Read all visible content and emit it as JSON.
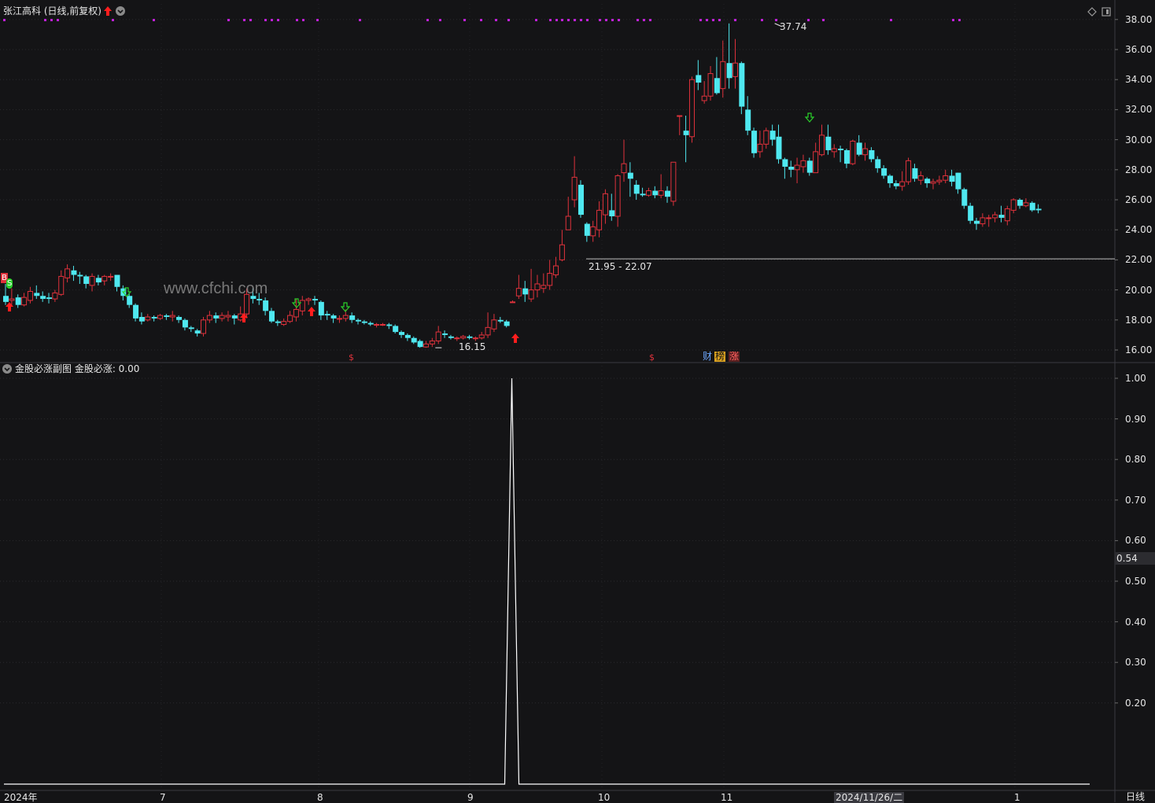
{
  "header": {
    "title": "张江高科 (日线,前复权)",
    "sub_title": "金股必涨副图  金股必涨: 0.00",
    "watermark": "www.cfchi.com",
    "period_label": "日线",
    "cursor_value": "0.54"
  },
  "annotations": {
    "high_label": "37.74",
    "low_label": "16.15",
    "range_label": "21.95 - 22.07",
    "b_marker": "B",
    "s_marker": "S",
    "dollar_marker": "$",
    "events": [
      "财",
      "榜",
      "涨"
    ]
  },
  "price_axis": [
    "38.00",
    "36.00",
    "34.00",
    "32.00",
    "30.00",
    "28.00",
    "26.00",
    "24.00",
    "22.00",
    "20.00",
    "18.00",
    "16.00"
  ],
  "indicator_axis": [
    "1.00",
    "0.90",
    "0.80",
    "0.70",
    "0.60",
    "0.50",
    "0.40",
    "0.30",
    "0.20"
  ],
  "date_axis": [
    "2024年",
    "7",
    "8",
    "9",
    "10",
    "11",
    "2024/11/26/二",
    "1"
  ],
  "colors": {
    "up": "#e0323c",
    "down": "#4fe8f0",
    "marker": "#c020d8",
    "arrow_up": "#ff1e1e",
    "arrow_down": "#2ad02a"
  },
  "chart_data": {
    "type": "candlestick",
    "price_range": [
      15.5,
      38.5
    ],
    "candles": [
      [
        19.6,
        19.2,
        20.4,
        19.0
      ],
      [
        19.3,
        19.4,
        20.1,
        19.0
      ],
      [
        19.5,
        19.0,
        19.7,
        18.8
      ],
      [
        19.0,
        19.5,
        19.8,
        18.9
      ],
      [
        19.3,
        19.9,
        20.2,
        19.1
      ],
      [
        19.8,
        19.6,
        20.3,
        19.4
      ],
      [
        19.6,
        19.4,
        19.9,
        19.2
      ],
      [
        19.5,
        19.4,
        19.8,
        19.1
      ],
      [
        19.4,
        19.8,
        20.0,
        19.2
      ],
      [
        19.7,
        20.9,
        21.3,
        19.6
      ],
      [
        20.8,
        21.4,
        21.7,
        20.5
      ],
      [
        21.3,
        21.0,
        21.6,
        20.6
      ],
      [
        21.0,
        20.9,
        21.2,
        20.4
      ],
      [
        20.9,
        20.4,
        21.0,
        20.1
      ],
      [
        20.3,
        20.9,
        21.1,
        19.9
      ],
      [
        20.8,
        20.5,
        21.0,
        20.3
      ],
      [
        20.6,
        20.9,
        21.0,
        20.3
      ],
      [
        20.9,
        20.9,
        21.1,
        20.6
      ],
      [
        21.0,
        20.2,
        21.0,
        19.9
      ],
      [
        20.1,
        19.6,
        20.3,
        19.3
      ],
      [
        19.6,
        19.0,
        19.8,
        18.8
      ],
      [
        19.0,
        18.1,
        19.1,
        17.9
      ],
      [
        18.2,
        17.9,
        18.5,
        17.7
      ],
      [
        18.0,
        18.2,
        18.4,
        17.9
      ],
      [
        18.2,
        18.1,
        18.3,
        17.9
      ],
      [
        18.1,
        18.3,
        18.4,
        18.0
      ],
      [
        18.3,
        18.2,
        18.4,
        18.0
      ],
      [
        18.2,
        18.3,
        18.6,
        17.9
      ],
      [
        18.2,
        18.0,
        18.3,
        17.8
      ],
      [
        18.0,
        17.5,
        18.1,
        17.3
      ],
      [
        17.5,
        17.4,
        17.6,
        17.2
      ],
      [
        17.3,
        17.1,
        17.4,
        16.9
      ],
      [
        17.1,
        18.0,
        18.2,
        16.9
      ],
      [
        18.0,
        18.3,
        18.6,
        17.8
      ],
      [
        18.3,
        18.1,
        18.5,
        17.8
      ],
      [
        18.1,
        18.3,
        18.5,
        17.9
      ],
      [
        18.2,
        18.3,
        18.6,
        17.9
      ],
      [
        18.3,
        18.1,
        18.4,
        17.7
      ],
      [
        18.0,
        18.4,
        18.9,
        17.9
      ],
      [
        18.4,
        19.7,
        20.1,
        18.1
      ],
      [
        19.6,
        19.4,
        20.1,
        19.1
      ],
      [
        19.4,
        19.3,
        19.8,
        19.0
      ],
      [
        19.3,
        18.6,
        19.5,
        18.3
      ],
      [
        18.6,
        17.9,
        18.8,
        17.8
      ],
      [
        17.9,
        17.8,
        18.0,
        17.6
      ],
      [
        17.7,
        17.9,
        18.1,
        17.6
      ],
      [
        17.9,
        18.3,
        18.6,
        17.8
      ],
      [
        18.2,
        18.7,
        19.4,
        17.9
      ],
      [
        18.6,
        19.3,
        19.6,
        18.3
      ],
      [
        19.3,
        19.4,
        19.5,
        19.0
      ],
      [
        19.4,
        19.3,
        19.6,
        19.0
      ],
      [
        19.2,
        18.3,
        19.3,
        18.0
      ],
      [
        18.4,
        18.3,
        18.6,
        18.0
      ],
      [
        18.3,
        18.1,
        18.4,
        17.8
      ],
      [
        18.1,
        18.1,
        18.3,
        17.8
      ],
      [
        18.1,
        18.3,
        18.7,
        17.9
      ],
      [
        18.3,
        18.0,
        18.5,
        17.8
      ],
      [
        18.0,
        17.9,
        18.1,
        17.7
      ],
      [
        17.9,
        17.8,
        18.0,
        17.7
      ],
      [
        17.8,
        17.7,
        17.9,
        17.6
      ],
      [
        17.7,
        17.7,
        17.8,
        17.5
      ],
      [
        17.7,
        17.7,
        17.8,
        17.6
      ],
      [
        17.7,
        17.6,
        17.8,
        17.4
      ],
      [
        17.6,
        17.2,
        17.7,
        17.1
      ],
      [
        17.2,
        17.0,
        17.3,
        16.8
      ],
      [
        17.0,
        16.8,
        17.1,
        16.6
      ],
      [
        16.8,
        16.5,
        16.9,
        16.4
      ],
      [
        16.6,
        16.2,
        16.7,
        16.15
      ],
      [
        16.2,
        16.4,
        16.6,
        16.15
      ],
      [
        16.4,
        16.6,
        16.8,
        16.2
      ],
      [
        16.6,
        17.2,
        17.6,
        16.4
      ],
      [
        17.1,
        17.0,
        17.3,
        16.8
      ],
      [
        16.9,
        16.8,
        17.0,
        16.7
      ],
      [
        16.8,
        16.8,
        16.9,
        16.6
      ],
      [
        16.8,
        16.9,
        17.0,
        16.7
      ],
      [
        16.9,
        16.8,
        17.0,
        16.7
      ],
      [
        16.8,
        16.8,
        16.9,
        16.6
      ],
      [
        16.8,
        17.0,
        17.2,
        16.7
      ],
      [
        17.0,
        17.5,
        18.5,
        16.8
      ],
      [
        17.4,
        18.0,
        18.4,
        17.2
      ],
      [
        18.0,
        17.9,
        18.2,
        17.8
      ],
      [
        17.9,
        17.6,
        18.0,
        17.5
      ],
      [
        19.2,
        19.2,
        19.3,
        19.2
      ],
      [
        19.6,
        20.1,
        21.0,
        19.4
      ],
      [
        20.1,
        19.7,
        20.6,
        19.2
      ],
      [
        19.4,
        20.0,
        21.4,
        19.2
      ],
      [
        20.0,
        20.4,
        21.0,
        19.5
      ],
      [
        20.1,
        20.3,
        21.1,
        19.8
      ],
      [
        20.3,
        21.1,
        22.0,
        20.0
      ],
      [
        21.0,
        21.6,
        22.2,
        20.8
      ],
      [
        22.0,
        23.0,
        24.0,
        21.9
      ],
      [
        24.0,
        24.9,
        26.2,
        24.0
      ],
      [
        26.0,
        27.5,
        28.9,
        25.5
      ],
      [
        27.0,
        25.0,
        27.3,
        24.8
      ],
      [
        24.4,
        23.6,
        24.5,
        23.2
      ],
      [
        23.6,
        24.2,
        24.6,
        23.2
      ],
      [
        24.0,
        25.3,
        25.9,
        23.5
      ],
      [
        25.0,
        26.4,
        26.7,
        24.4
      ],
      [
        25.3,
        24.9,
        26.4,
        24.6
      ],
      [
        24.9,
        27.6,
        27.7,
        24.2
      ],
      [
        27.8,
        28.4,
        30.0,
        27.2
      ],
      [
        27.8,
        27.4,
        28.5,
        26.2
      ],
      [
        27.0,
        26.4,
        27.3,
        26.0
      ],
      [
        26.4,
        26.3,
        26.8,
        26.2
      ],
      [
        26.3,
        26.6,
        26.8,
        26.2
      ],
      [
        26.6,
        26.3,
        26.9,
        26.1
      ],
      [
        26.3,
        26.6,
        27.7,
        26.1
      ],
      [
        26.6,
        26.2,
        26.9,
        25.8
      ],
      [
        25.9,
        28.5,
        28.5,
        25.6
      ],
      [
        31.6,
        31.6,
        31.6,
        30.3
      ],
      [
        30.6,
        30.3,
        31.6,
        28.5
      ],
      [
        30.2,
        34.0,
        34.2,
        29.8
      ],
      [
        34.3,
        33.8,
        35.3,
        33.3
      ],
      [
        32.6,
        32.9,
        33.9,
        32.4
      ],
      [
        32.9,
        34.4,
        34.9,
        32.6
      ],
      [
        34.1,
        33.1,
        35.5,
        33.0
      ],
      [
        33.4,
        35.2,
        36.6,
        32.8
      ],
      [
        35.1,
        34.1,
        37.74,
        33.4
      ],
      [
        34.2,
        35.1,
        36.7,
        33.4
      ],
      [
        35.1,
        32.2,
        35.2,
        31.7
      ],
      [
        32.0,
        30.6,
        32.9,
        30.3
      ],
      [
        30.6,
        29.1,
        30.8,
        28.8
      ],
      [
        29.2,
        29.7,
        30.6,
        28.8
      ],
      [
        29.7,
        30.6,
        30.8,
        29.4
      ],
      [
        30.6,
        30.0,
        31.0,
        29.6
      ],
      [
        30.2,
        28.7,
        31.0,
        28.4
      ],
      [
        28.7,
        28.2,
        28.8,
        27.4
      ],
      [
        28.2,
        28.0,
        28.6,
        27.5
      ],
      [
        28.0,
        28.3,
        28.8,
        27.1
      ],
      [
        28.2,
        28.6,
        29.0,
        27.8
      ],
      [
        28.6,
        27.8,
        28.8,
        27.6
      ],
      [
        27.8,
        29.2,
        29.8,
        27.8
      ],
      [
        29.0,
        30.3,
        31.0,
        28.9
      ],
      [
        30.2,
        29.3,
        31.0,
        29.0
      ],
      [
        29.2,
        29.4,
        29.7,
        28.8
      ],
      [
        29.4,
        29.3,
        29.6,
        28.5
      ],
      [
        29.3,
        28.4,
        29.4,
        28.1
      ],
      [
        28.4,
        29.9,
        30.0,
        28.3
      ],
      [
        29.8,
        29.0,
        30.3,
        28.9
      ],
      [
        29.0,
        29.4,
        29.8,
        28.6
      ],
      [
        29.3,
        28.7,
        29.5,
        28.5
      ],
      [
        28.7,
        28.1,
        28.9,
        27.8
      ],
      [
        28.1,
        27.6,
        28.3,
        27.4
      ],
      [
        27.6,
        27.1,
        27.7,
        26.8
      ],
      [
        27.1,
        26.9,
        27.3,
        26.7
      ],
      [
        26.9,
        27.2,
        27.9,
        26.6
      ],
      [
        27.2,
        28.6,
        28.8,
        27.0
      ],
      [
        28.1,
        27.4,
        28.4,
        27.2
      ],
      [
        27.3,
        27.6,
        27.9,
        27.0
      ],
      [
        27.4,
        27.1,
        27.5,
        26.8
      ],
      [
        27.1,
        27.2,
        27.4,
        26.7
      ],
      [
        27.2,
        27.3,
        27.6,
        27.0
      ],
      [
        27.3,
        27.6,
        28.0,
        27.1
      ],
      [
        27.6,
        27.2,
        28.0,
        26.9
      ],
      [
        27.8,
        26.7,
        27.8,
        26.4
      ],
      [
        26.7,
        25.6,
        26.8,
        25.4
      ],
      [
        25.6,
        24.6,
        25.8,
        24.4
      ],
      [
        24.6,
        24.4,
        24.8,
        24.0
      ],
      [
        24.4,
        24.8,
        25.1,
        24.2
      ],
      [
        24.8,
        24.8,
        25.0,
        24.2
      ],
      [
        24.8,
        25.0,
        25.2,
        24.5
      ],
      [
        25.0,
        24.8,
        25.6,
        24.5
      ],
      [
        24.6,
        25.4,
        25.6,
        24.3
      ],
      [
        25.3,
        26.0,
        26.1,
        25.1
      ],
      [
        26.0,
        25.6,
        26.1,
        25.4
      ],
      [
        25.6,
        25.8,
        26.1,
        25.5
      ],
      [
        25.8,
        25.3,
        25.9,
        25.2
      ],
      [
        25.4,
        25.3,
        25.7,
        25.1
      ]
    ],
    "indicator_series": {
      "name": "金股必涨",
      "value_range": [
        0,
        1
      ],
      "baseline_value": 0,
      "spike_value": 1.0,
      "spike_index": 82,
      "current_value": 0.0
    }
  }
}
